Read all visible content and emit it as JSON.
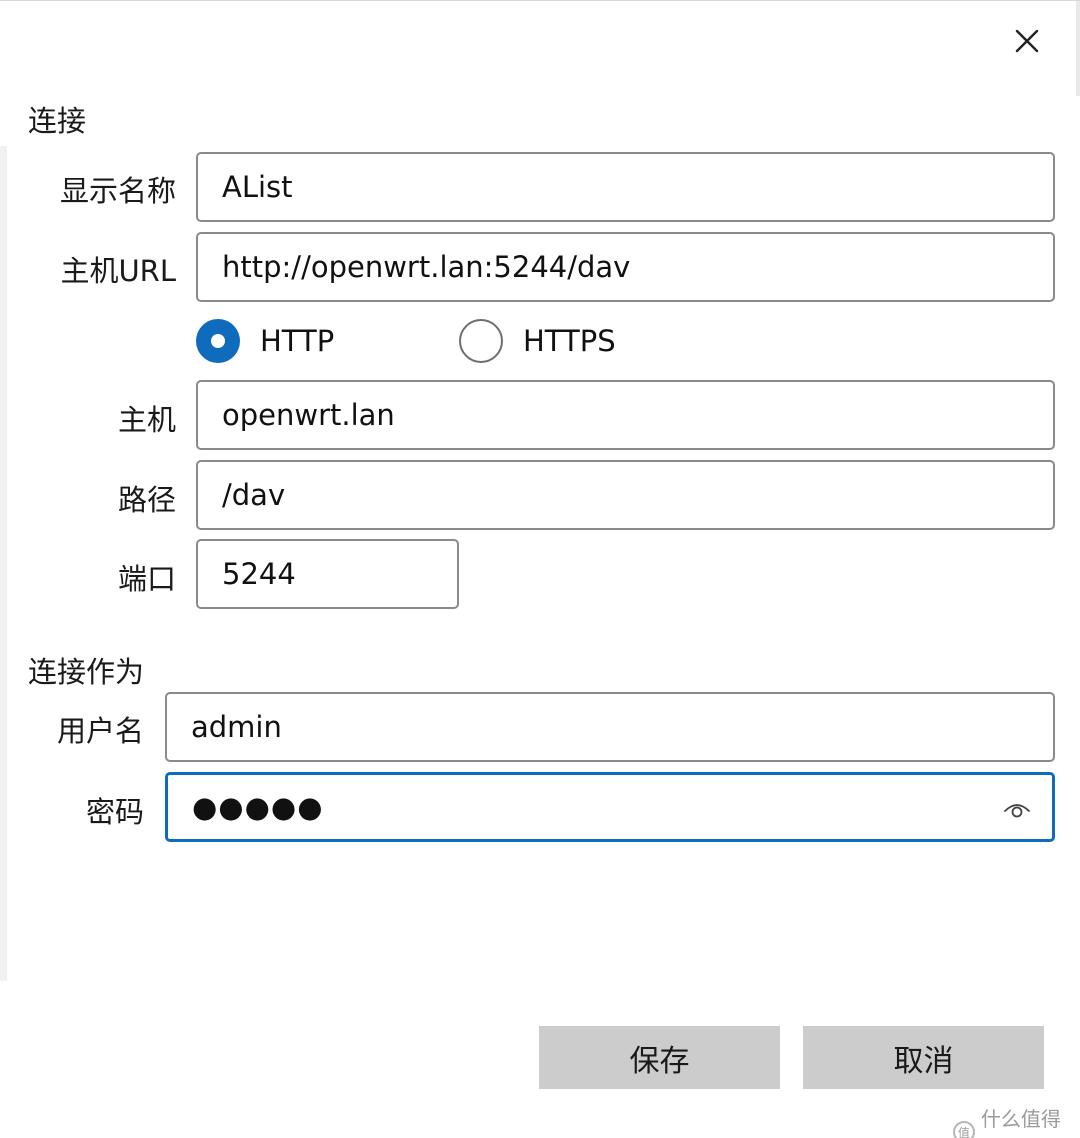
{
  "dialog": {
    "sections": {
      "connection": "连接",
      "connect_as": "连接作为"
    },
    "fields": {
      "display_name": {
        "label": "显示名称",
        "value": "AList"
      },
      "host_url": {
        "label": "主机URL",
        "value": "http://openwrt.lan:5244/dav"
      },
      "host": {
        "label": "主机",
        "value": "openwrt.lan"
      },
      "path": {
        "label": "路径",
        "value": "/dav"
      },
      "port": {
        "label": "端口",
        "value": "5244"
      },
      "username": {
        "label": "用户名",
        "value": "admin"
      },
      "password": {
        "label": "密码",
        "masked_value": "●●●●●"
      }
    },
    "protocol": {
      "options": [
        "HTTP",
        "HTTPS"
      ],
      "selected": "HTTP"
    },
    "buttons": {
      "save": "保存",
      "cancel": "取消"
    },
    "icons": {
      "close": "close-icon",
      "reveal_password": "eye-icon"
    },
    "colors": {
      "accent": "#0f6cbd",
      "button_bg": "#cccccc",
      "field_border": "#8a8a8a"
    }
  },
  "watermark": {
    "text": "什么值得买"
  }
}
